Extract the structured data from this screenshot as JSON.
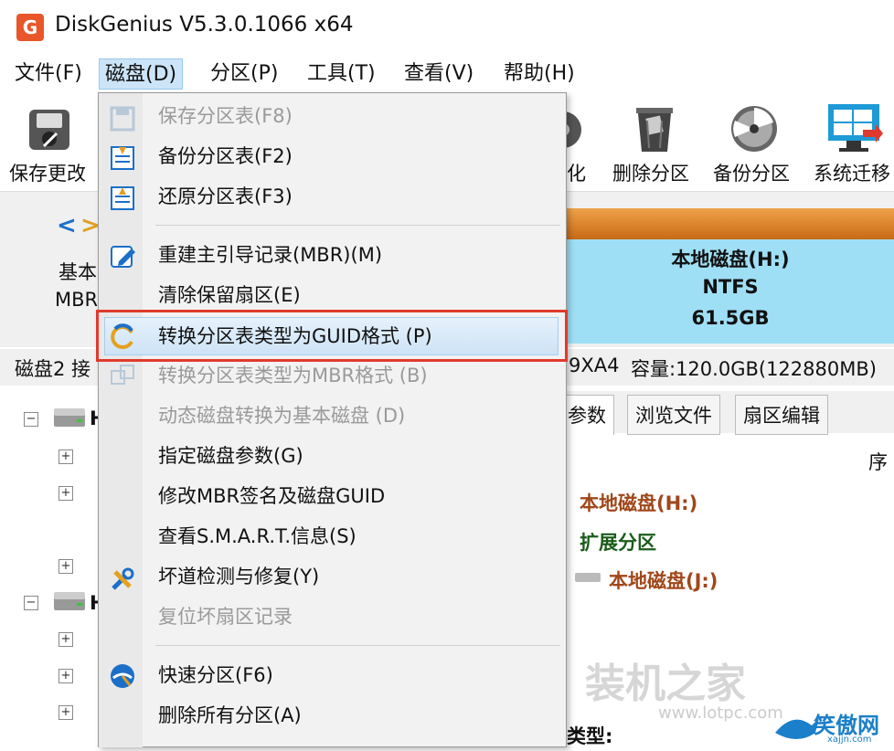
{
  "window": {
    "title": "DiskGenius V5.3.0.1066 x64",
    "icon": "diskgenius-logo-icon",
    "icon_letter": "G"
  },
  "menubar": [
    {
      "label": "文件(F)"
    },
    {
      "label": "磁盘(D)",
      "active": true
    },
    {
      "label": "分区(P)"
    },
    {
      "label": "工具(T)"
    },
    {
      "label": "查看(V)"
    },
    {
      "label": "帮助(H)"
    }
  ],
  "toolbar": {
    "save_label": "保存更改",
    "partial_label": "化",
    "delete_label": "删除分区",
    "backup_label": "备份分区",
    "migrate_label": "系统迁移"
  },
  "diskbar": {
    "nav_left": "<",
    "nav_right": ">",
    "disk_type_partial": "基本",
    "disk_format_partial": "MBR",
    "partition": {
      "name": "本地磁盘(H:)",
      "fs": "NTFS",
      "size": "61.5GB"
    }
  },
  "info_line": {
    "left": "磁盘2 接",
    "model_partial": "9XA4",
    "capacity": "容量:120.0GB(122880MB)"
  },
  "tree": {
    "node_partial_1": "H",
    "node_partial_2": "H"
  },
  "tabs": [
    {
      "label": "参数"
    },
    {
      "label": "浏览文件"
    },
    {
      "label": "扇区编辑"
    }
  ],
  "right_panel": {
    "column_partial": "序",
    "rows": [
      {
        "label": "本地磁盘(H:)",
        "color": "#a0471a"
      },
      {
        "label": "扩展分区",
        "color": "#1a5c1a"
      },
      {
        "label": "本地磁盘(J:)",
        "color": "#a0471a"
      }
    ],
    "bottom_partial": "类型:"
  },
  "dropdown": {
    "items": [
      {
        "label": "保存分区表(F8)",
        "disabled": true,
        "icon": "save-disk-icon"
      },
      {
        "label": "备份分区表(F2)",
        "disabled": false,
        "icon": "backup-table-icon"
      },
      {
        "label": "还原分区表(F3)",
        "disabled": false,
        "icon": "restore-table-icon"
      },
      {
        "label": "重建主引导记录(MBR)(M)",
        "disabled": false,
        "icon": "rebuild-mbr-icon"
      },
      {
        "label": "清除保留扇区(E)",
        "disabled": false
      },
      {
        "label": "转换分区表类型为GUID格式 (P)",
        "disabled": false,
        "highlighted": true,
        "icon": "convert-refresh-icon"
      },
      {
        "label": "转换分区表类型为MBR格式 (B)",
        "disabled": true,
        "icon": "convert-mbr-icon"
      },
      {
        "label": "动态磁盘转换为基本磁盘 (D)",
        "disabled": true
      },
      {
        "label": "指定磁盘参数(G)",
        "disabled": false
      },
      {
        "label": "修改MBR签名及磁盘GUID",
        "disabled": false
      },
      {
        "label": "查看S.M.A.R.T.信息(S)",
        "disabled": false
      },
      {
        "label": "坏道检测与修复(Y)",
        "disabled": false,
        "icon": "repair-tools-icon"
      },
      {
        "label": "复位坏扇区记录",
        "disabled": true
      },
      {
        "label": "快速分区(F6)",
        "disabled": false,
        "icon": "quick-partition-icon"
      },
      {
        "label": "删除所有分区(A)",
        "disabled": false
      }
    ]
  },
  "watermark": {
    "text": "装机之家",
    "url": "www.lotpc.com",
    "logo_text": "笑傲网",
    "logo_url": "xajjn.com"
  },
  "colors": {
    "accent_blue": "#cce4f7",
    "highlight_red": "#e03a2c",
    "partition_fill": "#9fdff5",
    "orange_strip": "#e08a2a"
  }
}
